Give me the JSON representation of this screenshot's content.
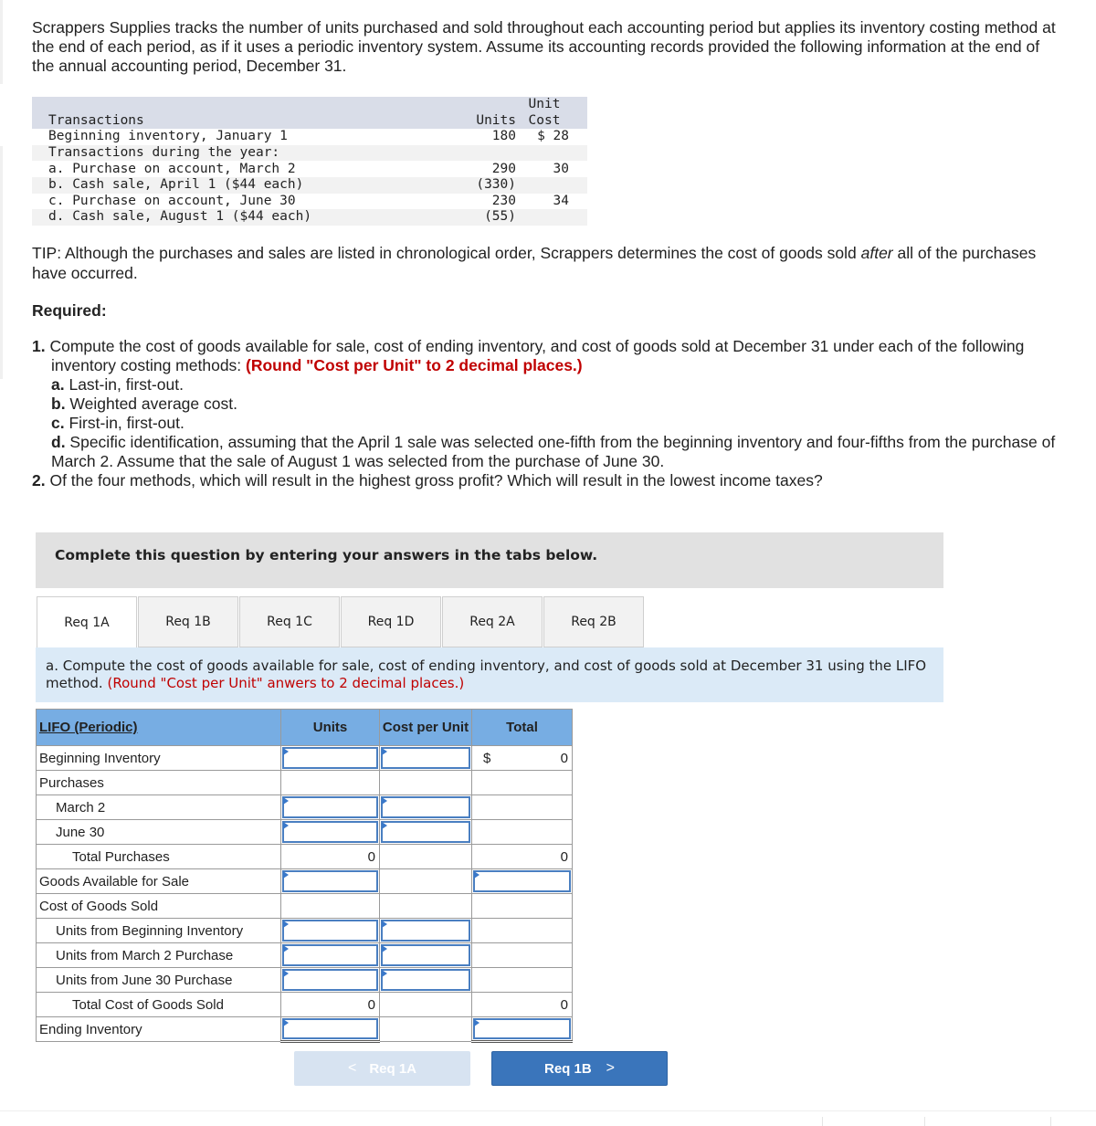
{
  "intro": "Scrappers Supplies tracks the number of units purchased and sold throughout each accounting period but applies its inventory costing method at the end of each period, as if it uses a periodic inventory system. Assume its accounting records provided the following information at the end of the annual accounting period, December 31.",
  "transactions": {
    "header": {
      "col1": "Transactions",
      "col2": "Units",
      "col3_line1": "Unit",
      "col3_line2": "Cost"
    },
    "rows": [
      {
        "label": "Beginning inventory, January 1",
        "units": "180",
        "cost": "$ 28"
      },
      {
        "label": "Transactions during the year:",
        "units": "",
        "cost": ""
      },
      {
        "label": "a. Purchase on account, March 2",
        "units": "290",
        "cost": "30"
      },
      {
        "label": "b. Cash sale, April 1 ($44 each)",
        "units": "(330)",
        "cost": ""
      },
      {
        "label": "c. Purchase on account, June 30",
        "units": "230",
        "cost": "34"
      },
      {
        "label": "d. Cash sale, August 1 ($44 each)",
        "units": "(55)",
        "cost": ""
      }
    ]
  },
  "tip": {
    "before": "TIP: Although the purchases and sales are listed in chronological order, Scrappers determines the cost of goods sold ",
    "emphasis": "after",
    "after": " all of the purchases have occurred."
  },
  "required_heading": "Required:",
  "requirements": {
    "r1_num": "1.",
    "r1_text": " Compute the cost of goods available for sale, cost of ending inventory, and cost of goods sold at December 31 under each of the following inventory costing methods: ",
    "r1_note": "(Round \"Cost per Unit\" to 2 decimal places.)",
    "a_key": "a.",
    "a_text": " Last-in, first-out.",
    "b_key": "b.",
    "b_text": " Weighted average cost.",
    "c_key": "c.",
    "c_text": " First-in, first-out.",
    "d_key": "d.",
    "d_text": " Specific identification, assuming that the April 1 sale was selected one-fifth from the beginning inventory and four-fifths from the purchase of March 2. Assume that the sale of August 1 was selected from the purchase of June 30.",
    "r2_num": "2.",
    "r2_text": " Of the four methods, which will result in the highest gross profit? Which will result in the lowest income taxes?"
  },
  "complete_box": "Complete this question by entering your answers in the tabs below.",
  "tabs": [
    {
      "label": "Req 1A",
      "active": true
    },
    {
      "label": "Req 1B",
      "active": false
    },
    {
      "label": "Req 1C",
      "active": false
    },
    {
      "label": "Req 1D",
      "active": false
    },
    {
      "label": "Req 2A",
      "active": false
    },
    {
      "label": "Req 2B",
      "active": false
    }
  ],
  "instruction": {
    "text": "a. Compute the cost of goods available for sale, cost of ending inventory, and cost of goods sold at December 31 using the LIFO method. ",
    "note": "(Round \"Cost per Unit\" anwers to 2 decimal places.)"
  },
  "lifo_table": {
    "headers": {
      "label": "LIFO (Periodic)",
      "units": "Units",
      "cost_per_unit": "Cost per Unit",
      "total": "Total"
    },
    "rows": {
      "beginning_inventory": {
        "label": "Beginning Inventory",
        "units": "",
        "cost_per_unit": "",
        "currency": "$",
        "total": "0"
      },
      "purchases": {
        "label": "Purchases"
      },
      "march2": {
        "label": "March 2",
        "units": "",
        "cost_per_unit": ""
      },
      "june30": {
        "label": "June 30",
        "units": "",
        "cost_per_unit": ""
      },
      "total_purchases": {
        "label": "Total Purchases",
        "units": "0",
        "total": "0"
      },
      "goods_available": {
        "label": "Goods Available for Sale",
        "units": "",
        "total": ""
      },
      "cogs": {
        "label": "Cost of Goods Sold"
      },
      "from_beginning": {
        "label": "Units from Beginning Inventory",
        "units": "",
        "cost_per_unit": ""
      },
      "from_march2": {
        "label": "Units from March 2 Purchase",
        "units": "",
        "cost_per_unit": ""
      },
      "from_june30": {
        "label": "Units from June 30 Purchase",
        "units": "",
        "cost_per_unit": ""
      },
      "total_cogs": {
        "label": "Total Cost of Goods Sold",
        "units": "0",
        "total": "0"
      },
      "ending_inventory": {
        "label": "Ending Inventory",
        "units": "",
        "total": ""
      }
    }
  },
  "nav": {
    "prev_label": "Req 1A",
    "next_label": "Req 1B",
    "prev_icon": "chevron-left-icon",
    "next_icon": "chevron-right-icon"
  }
}
